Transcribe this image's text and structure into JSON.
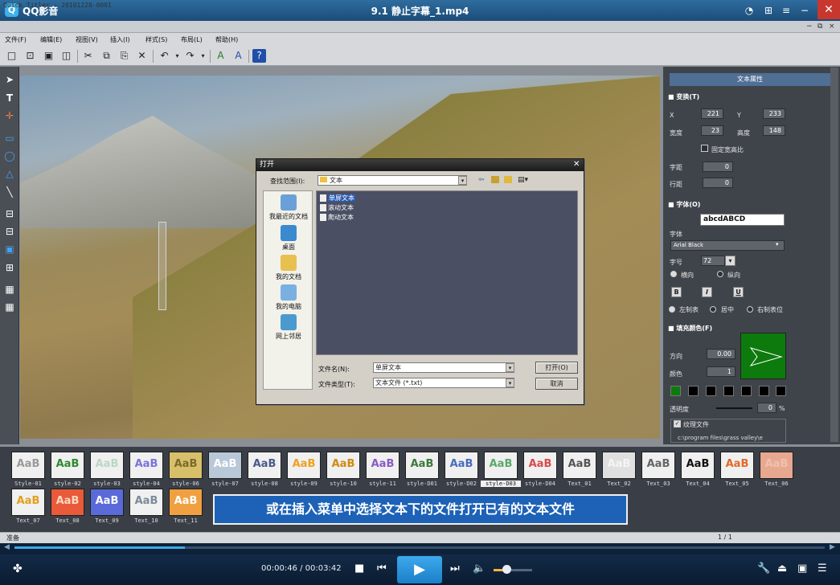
{
  "player": {
    "app_name": "QQ影音",
    "video_title": "9.1 静止字幕_1.mp4",
    "time_current": "00:00:46",
    "time_separator": " / ",
    "time_total": "00:03:42",
    "progress_fraction": 0.21,
    "volume_fraction": 0.33
  },
  "quick_titler": {
    "caption": "Quick Titler - 20101228-0001",
    "menus": [
      "文件(F)",
      "编辑(E)",
      "视图(V)",
      "插入(I)",
      "样式(S)",
      "布局(L)",
      "帮助(H)"
    ],
    "status_left": "准备",
    "status_page": "1 / 1"
  },
  "open_dialog": {
    "title": "打开",
    "look_in_label": "查找范围(I):",
    "look_in_value": "文本",
    "places": [
      "我最近的文档",
      "桌面",
      "我的文档",
      "我的电脑",
      "网上邻居"
    ],
    "files": [
      "单屏文本",
      "滚动文本",
      "爬动文本"
    ],
    "filename_label": "文件名(N):",
    "filename_value": "单屏文本",
    "filetype_label": "文件类型(T):",
    "filetype_value": "文本文件 (*.txt)",
    "open_button": "打开(O)",
    "cancel_button": "取消"
  },
  "properties": {
    "panel_title": "文本属性",
    "transform_header": "变换(T)",
    "x_label": "X",
    "x_value": "221",
    "y_label": "Y",
    "y_value": "233",
    "width_label": "宽度",
    "width_value": "23",
    "height_label": "高度",
    "height_value": "148",
    "fixed_ratio_label": "固定宽高比",
    "char_spacing_label": "字距",
    "char_spacing_value": "0",
    "line_spacing_label": "行距",
    "line_spacing_value": "0",
    "font_header": "字体(O)",
    "font_preview": "abcdABCD",
    "font_label": "字体",
    "font_value": "Arial Black",
    "size_label": "字号",
    "size_value": "72",
    "horizontal_label": "横向",
    "vertical_label": "纵向",
    "bold": "B",
    "italic": "I",
    "underline": "U",
    "align_left_label": "左制表",
    "align_center_label": "居中",
    "align_right_label": "右制表位",
    "fill_header": "填充颜色(F)",
    "direction_label": "方向",
    "direction_value": "0.00",
    "color_label": "颜色",
    "color_value": "1",
    "opacity_label": "透明度",
    "opacity_value": "0",
    "opacity_unit": "%",
    "texture_label": "纹理文件",
    "texture_path": "c:\\program files\\grass valley\\e"
  },
  "styles": {
    "row1": [
      {
        "label": "Style-01",
        "color": "#9a9a9a",
        "bg": "#f0f0f0"
      },
      {
        "label": "style-02",
        "color": "#2e8a2e",
        "bg": "#f0f0f0"
      },
      {
        "label": "style-03",
        "color": "#bcd6c4",
        "bg": "#f0f0f0"
      },
      {
        "label": "style-04",
        "color": "#7a74d8",
        "bg": "#f0f0f0"
      },
      {
        "label": "style-06",
        "color": "#7b6a2a",
        "bg": "#d8c06a"
      },
      {
        "label": "style-07",
        "color": "#ffffff",
        "bg": "#b8c8d8"
      },
      {
        "label": "style-08",
        "color": "#4a5a8a",
        "bg": "#f0f0f0"
      },
      {
        "label": "style-09",
        "color": "#f0a020",
        "bg": "#f0f0f0"
      },
      {
        "label": "style-10",
        "color": "#d08a10",
        "bg": "#f0f0f0"
      },
      {
        "label": "style-11",
        "color": "#8a5ac8",
        "bg": "#f0f0f0"
      },
      {
        "label": "style-D01",
        "color": "#3a7a3a",
        "bg": "#f0f0f0"
      },
      {
        "label": "style-D02",
        "color": "#4a6ac0",
        "bg": "#f0f0f0"
      },
      {
        "label": "style-D03",
        "color": "#5aa86a",
        "bg": "#f0f0f0"
      },
      {
        "label": "style-D04",
        "color": "#d84a4a",
        "bg": "#f0f0f0"
      },
      {
        "label": "Text_01",
        "color": "#555555",
        "bg": "#f0f0f0"
      },
      {
        "label": "Text_02",
        "color": "#f4f4f4",
        "bg": "#e0e0e0"
      },
      {
        "label": "Text_03",
        "color": "#666666",
        "bg": "#f0f0f0"
      },
      {
        "label": "Text_04",
        "color": "#111111",
        "bg": "#f0f0f0"
      },
      {
        "label": "Text_05",
        "color": "#e06a2a",
        "bg": "#f0f0f0"
      },
      {
        "label": "Text_06",
        "color": "#f0c0b0",
        "bg": "#e8a890"
      }
    ],
    "row2": [
      {
        "label": "Text_07",
        "color": "#e0a020",
        "bg": "#f0f0f0"
      },
      {
        "label": "Text_08",
        "color": "#ffd8c0",
        "bg": "#e85a3a"
      },
      {
        "label": "Text_09",
        "color": "#ffffff",
        "bg": "#5a6ad8"
      },
      {
        "label": "Text_10",
        "color": "#7a8a9a",
        "bg": "#f0f0f0"
      },
      {
        "label": "Text_11",
        "color": "#ffffff",
        "bg": "#f0a040"
      }
    ],
    "sample_text": "AaB",
    "selected": "style-D03"
  },
  "subtitle": "或在插入菜单中选择文本下的文件打开已有的文本文件"
}
